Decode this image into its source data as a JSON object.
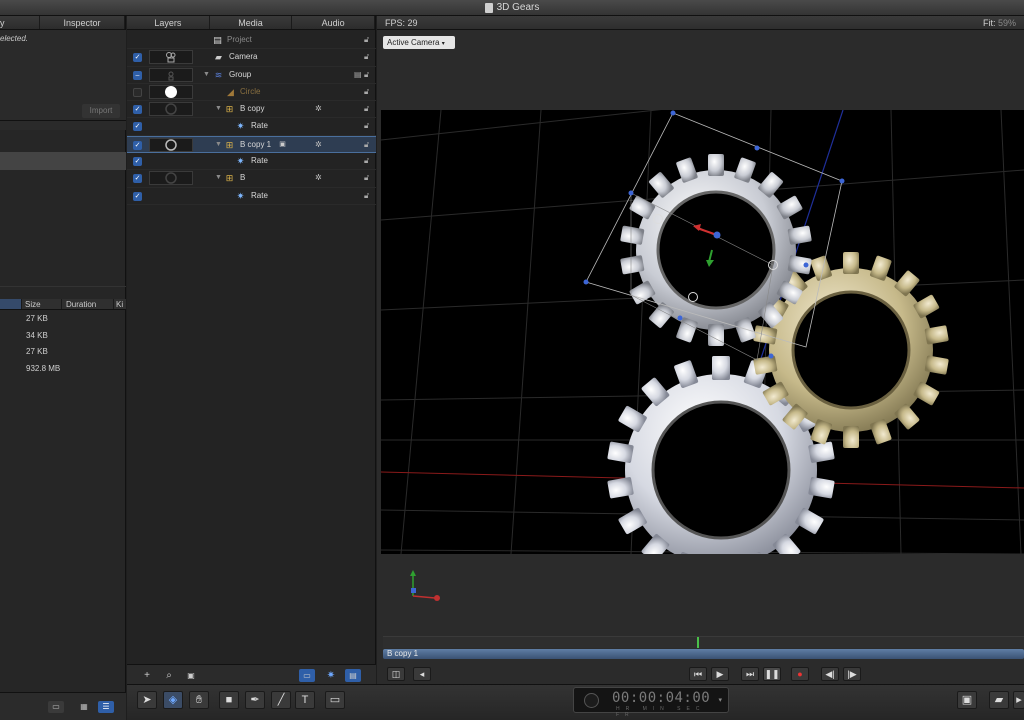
{
  "window": {
    "title": "3D Gears"
  },
  "left_panel": {
    "tabs": [
      {
        "label": "y"
      },
      {
        "label": "Inspector"
      }
    ],
    "no_selection_text": "elected.",
    "import_label": "Import",
    "file_columns": [
      "",
      "Size",
      "Duration",
      "Ki"
    ],
    "files": [
      {
        "size": "27 KB"
      },
      {
        "size": "34 KB"
      },
      {
        "size": "27 KB"
      },
      {
        "size": "932.8 MB"
      }
    ]
  },
  "layers_panel": {
    "tabs": [
      {
        "label": "Layers"
      },
      {
        "label": "Media"
      },
      {
        "label": "Audio"
      }
    ],
    "rows": [
      {
        "name": "Project",
        "icon": "project-icon",
        "checked": false
      },
      {
        "name": "Camera",
        "icon": "camera-icon",
        "checked": true
      },
      {
        "name": "Group",
        "icon": "group-icon",
        "checked": "mixed"
      },
      {
        "name": "Circle",
        "icon": "shape-icon",
        "checked": false
      },
      {
        "name": "B copy",
        "icon": "replicator-icon",
        "checked": true
      },
      {
        "name": "Rate",
        "icon": "behavior-icon",
        "checked": true
      },
      {
        "name": "B copy 1",
        "icon": "replicator-icon",
        "checked": true,
        "selected": true
      },
      {
        "name": "Rate",
        "icon": "behavior-icon",
        "checked": true
      },
      {
        "name": "B",
        "icon": "replicator-icon",
        "checked": true
      },
      {
        "name": "Rate",
        "icon": "behavior-icon",
        "checked": true
      }
    ]
  },
  "viewer": {
    "fps_label": "FPS: 29",
    "fit_label": "Fit:",
    "fit_value": "59%",
    "camera_select": "Active Camera",
    "timeline_clip": "B copy 1"
  },
  "toolbar": {
    "timecode": "00:00:04:00",
    "timecode_units": "HR MIN SEC FR"
  },
  "colors": {
    "selection": "#2e3d52",
    "accent": "#2f5fa8",
    "clip": "#5f7ea6",
    "gear_silver": "#dcdfe6",
    "gear_gold": "#cbbf92"
  }
}
